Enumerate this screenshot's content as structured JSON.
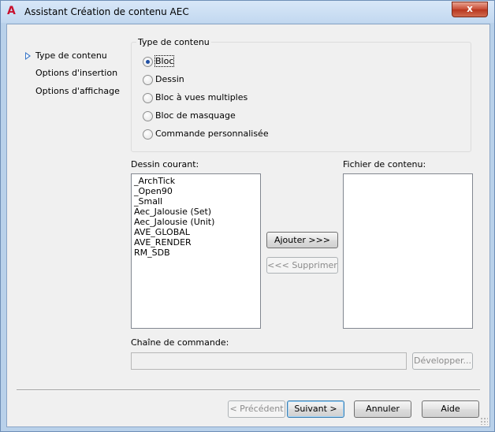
{
  "window": {
    "title": "Assistant Création de contenu AEC",
    "close_label": "x"
  },
  "nav": {
    "items": [
      {
        "label": "Type de contenu",
        "active": true
      },
      {
        "label": "Options d'insertion",
        "active": false
      },
      {
        "label": "Options d'affichage",
        "active": false
      }
    ]
  },
  "content_type": {
    "legend": "Type de contenu",
    "options": [
      {
        "label": "Bloc",
        "checked": true
      },
      {
        "label": "Dessin",
        "checked": false
      },
      {
        "label": "Bloc à vues multiples",
        "checked": false
      },
      {
        "label": "Bloc de masquage",
        "checked": false
      },
      {
        "label": "Commande personnalisée",
        "checked": false
      }
    ]
  },
  "current_drawing": {
    "label": "Dessin courant:",
    "items": [
      "_ArchTick",
      "_Open90",
      "_Small",
      "Aec_Jalousie (Set)",
      "Aec_Jalousie (Unit)",
      "AVE_GLOBAL",
      "AVE_RENDER",
      "RM_SDB"
    ]
  },
  "content_file": {
    "label": "Fichier de contenu:",
    "items": []
  },
  "transfer": {
    "add_label": "Ajouter >>>",
    "remove_label": "<<< Supprimer"
  },
  "command": {
    "label": "Chaîne de commande:",
    "value": "",
    "expand_label": "Développer..."
  },
  "footer": {
    "previous_label": "< Précédent",
    "next_label": "Suivant >",
    "cancel_label": "Annuler",
    "help_label": "Aide"
  }
}
